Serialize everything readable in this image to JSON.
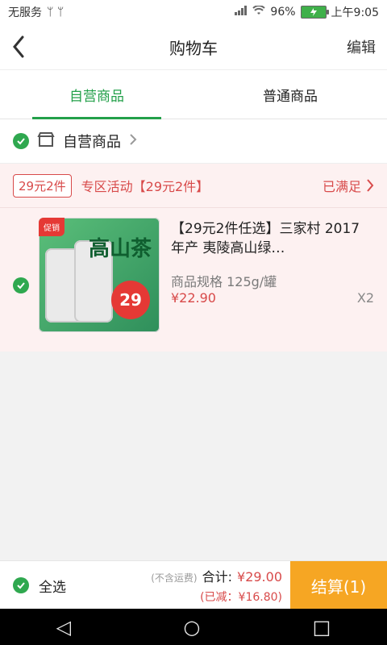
{
  "status_bar": {
    "carrier": "无服务",
    "usb_icons": "ᛘ ᛘ",
    "battery": "96%",
    "time": "上午9:05"
  },
  "header": {
    "title": "购物车",
    "edit": "编辑"
  },
  "tabs": [
    {
      "label": "自营商品",
      "active": true
    },
    {
      "label": "普通商品",
      "active": false
    }
  ],
  "store": {
    "name": "自营商品"
  },
  "promotion": {
    "badge": "29元2件",
    "text": "专区活动【29元2件】",
    "status": "已满足"
  },
  "item": {
    "name": "【29元2件任选】三家村 2017 年产 夷陵高山绿…",
    "spec": "商品规格  125g/罐",
    "price": "¥22.90",
    "quantity": "X2",
    "thumb_label": "高山茶",
    "thumb_price": "29",
    "thumb_corner": "促销"
  },
  "summary": {
    "select_all": "全选",
    "no_shipping": "(不含运费)",
    "total_label": "合计:",
    "total_amount": "¥29.00",
    "discount": "(已减：¥16.80)",
    "checkout": "结算(1)"
  },
  "nav": {
    "back": "◁",
    "home": "○",
    "recent": "□"
  },
  "colors": {
    "accent_green": "#23a04a",
    "promo_red": "#d84a4a",
    "checkout_orange": "#f6a623"
  }
}
